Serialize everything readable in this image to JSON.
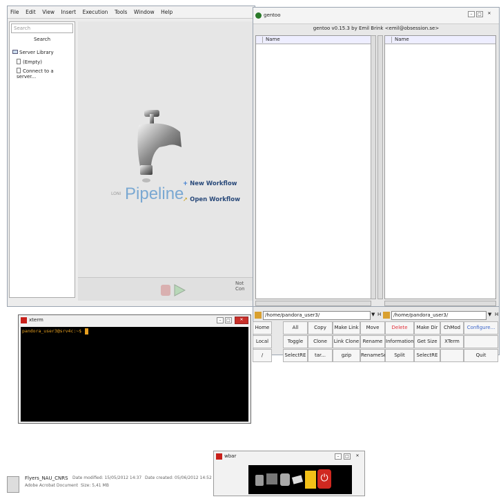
{
  "pipeline": {
    "menu": [
      "File",
      "Edit",
      "View",
      "Insert",
      "Execution",
      "Tools",
      "Window",
      "Help"
    ],
    "search_placeholder": "Search",
    "search_button": "Search",
    "tree": {
      "root": "Server Library",
      "items": [
        "(Empty)",
        "Connect to a server..."
      ]
    },
    "logo_prefix": "LONI",
    "logo_word": "Pipeline",
    "new_workflow": "New Workflow",
    "open_workflow": "Open Workflow",
    "status": "Not Con"
  },
  "gentoo": {
    "title": "gentoo",
    "subtitle": "gentoo v0.15.3 by Emil Brink <emil@obsession.se>",
    "left_col": "Name",
    "right_col": "Name",
    "left_path": "/home/pandora_user3/",
    "right_path": "/home/pandora_user3/",
    "h_label": "H",
    "buttons": {
      "row1": [
        "Home",
        "All",
        "Copy",
        "Make Link",
        "Move",
        "Delete",
        "Make Dir",
        "ChMod",
        "Configure..."
      ],
      "row2": [
        "Local",
        "Toggle",
        "Clone",
        "Link Clone",
        "Rename",
        "Information",
        "Get Size",
        "XTerm",
        ""
      ],
      "row3": [
        "/",
        "SelectRE",
        "tar...",
        "gzip",
        "RenameSeq",
        "Split",
        "SelectRE",
        "",
        "Quit"
      ]
    },
    "colors": {
      "delete": "#e0303a",
      "configure": "#3a64c8"
    }
  },
  "xterm": {
    "title": "xterm",
    "prompt": "pandora_user3@srv4c:~$"
  },
  "wbar": {
    "title": "wbar"
  },
  "fileinfo": {
    "name": "Flyers_NAU_CNRS",
    "type": "Adobe Acrobat Document",
    "modified": "Date modified: 15/05/2012 14:37",
    "size": "Size: 5,41 MB",
    "created": "Date created: 05/06/2012 14:52"
  }
}
